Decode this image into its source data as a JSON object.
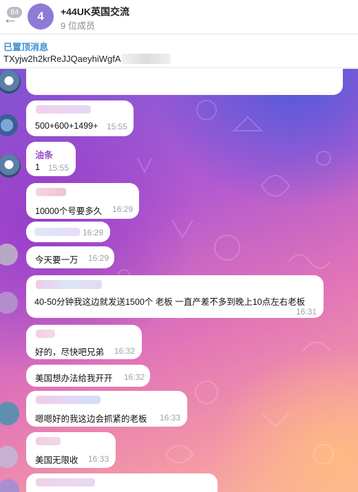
{
  "header": {
    "unread_count": "84",
    "avatar_letter": "4",
    "title": "+44UK英国交流",
    "subtitle": "9 位成员"
  },
  "pinned": {
    "label": "已置顶消息",
    "text": "TXyjw2h2krReJJQaeyhiWgfA4"
  },
  "messages": [
    {
      "text": "500+600+1499+",
      "time": "15:55"
    },
    {
      "sender": "油条",
      "text": "1",
      "time": "15:55"
    },
    {
      "text": "10000个号要多久",
      "time": "16:29"
    },
    {
      "text": "",
      "time": "16:29"
    },
    {
      "text": "今天要一万",
      "time": "16:29"
    },
    {
      "text": "40-50分钟我这边就发送1500个 老板 一直产差不多到晚上10点左右老板",
      "time": "16:31"
    },
    {
      "text": "好的，尽快吧兄弟",
      "time": "16:32"
    },
    {
      "text": "美国想办法给我开开",
      "time": "16:32"
    },
    {
      "text": "嗯嗯好的我这边会抓紧的老板",
      "time": "16:33"
    },
    {
      "text": "美国无限收",
      "time": "16:33"
    }
  ],
  "colors": {
    "accent": "#3a8fd0",
    "sender_name": "#9a4fc8",
    "group_avatar": "#8f7bd6",
    "time": "#9aa3ab"
  },
  "icons": {
    "back": "arrow-left-icon"
  }
}
